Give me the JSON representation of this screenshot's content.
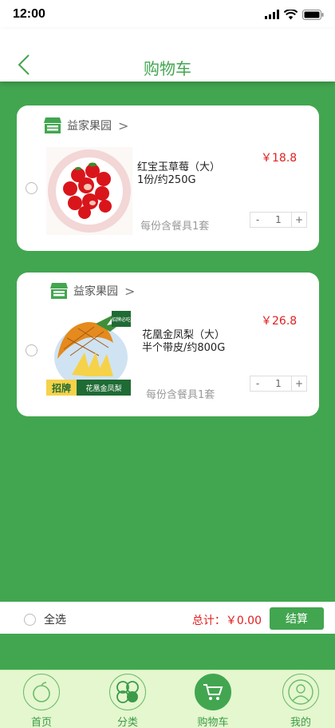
{
  "status": {
    "time": "12:00"
  },
  "nav": {
    "title": "购物车"
  },
  "cart": {
    "items": [
      {
        "store": "益家果园",
        "name": "红宝玉草莓（大）",
        "spec": "1份/约250G",
        "price": "￥18.8",
        "note": "每份含餐具1套",
        "qty": "1",
        "minus": "-",
        "plus": "+"
      },
      {
        "store": "益家果园",
        "name": "花凰金凤梨（大）",
        "spec": "半个带皮/约800G",
        "price": "￥26.8",
        "note": "每份含餐具1套",
        "qty": "1",
        "minus": "-",
        "plus": "+",
        "image_badge": "招牌",
        "image_caption": "花凰金凤梨",
        "image_tag": "招牌必吃"
      }
    ]
  },
  "checkout": {
    "select_all": "全选",
    "total": "总计：￥0.00",
    "button": "结算"
  },
  "tabs": [
    {
      "label": "首页",
      "icon": "home-fruit-icon"
    },
    {
      "label": "分类",
      "icon": "category-icon"
    },
    {
      "label": "购物车",
      "icon": "cart-icon"
    },
    {
      "label": "我的",
      "icon": "profile-icon"
    }
  ],
  "colors": {
    "accent": "#42a650",
    "price": "#e02020",
    "tabbar_bg": "#e4f7cf"
  }
}
